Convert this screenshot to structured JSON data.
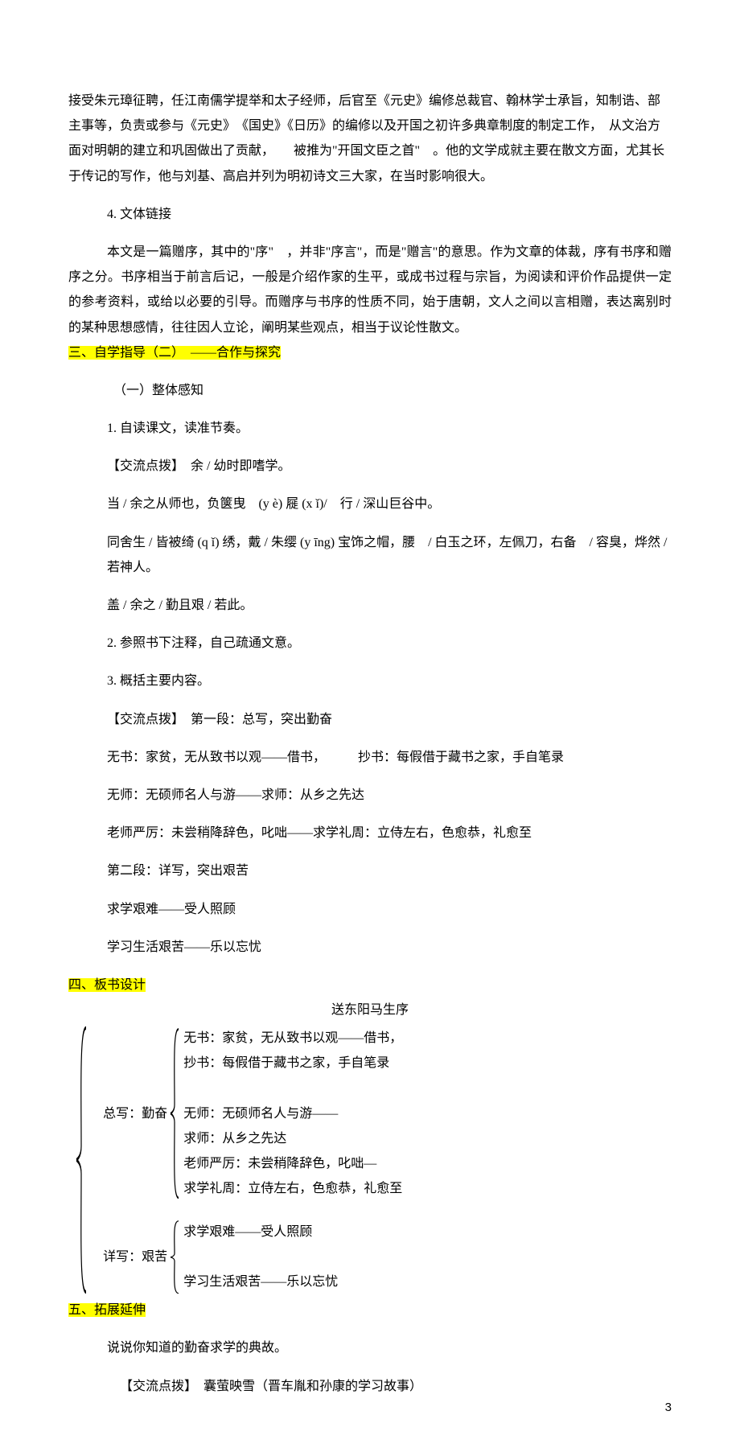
{
  "intro_paragraph": "接受朱元璋征聘，任江南儒学提举和太子经师，后官至《元史》编修总裁官、翰林学士承旨，知制诰、部主事等，负责或参与《元史》　《国史》《日历》的编修以及开国之初许多典章制度的制定工作，　从文治方面对明朝的建立和巩固做出了贡献，　　被推为\"开国文臣之首\"　。他的文学成就主要在散文方面，尤其长于传记的写作，他与刘基、高启并列为明初诗文三大家，在当时影响很大。",
  "item4_label": "4. 文体链接",
  "item4_para": "本文是一篇赠序，其中的\"序\"　，并非\"序言\"，而是\"赠言\"的意思。作为文章的体裁，序有书序和赠序之分。书序相当于前言后记，一般是介绍作家的生平，或成书过程与宗旨，为阅读和评价作品提供一定的参考资料，或给以必要的引导。而赠序与书序的性质不同，始于唐朝，文人之间以言相赠，表达离别时的某种思想感情，往往因人立论，阐明某些观点，相当于议论性散文。",
  "sec3_title": "三、自学指导（二）　——合作与探究",
  "sec3_sub1": "（一）整体感知",
  "sec3_p1": "1. 自读课文，读准节奏。",
  "sec3_p2": "【交流点拨】　余 / 幼时即嗜学。",
  "sec3_p3": "当 / 余之从师也，负箧曳　(y è) 屣 (x ǐ)/　行 / 深山巨谷中。",
  "sec3_p4": "同舍生 / 皆被绮 (q ǐ) 绣，戴 / 朱缨 (y īng) 宝饰之帽，腰　/ 白玉之环，左佩刀，右备　/ 容臭，烨然 / 若神人。",
  "sec3_p5": "盖 / 余之 / 勤且艰 / 若此。",
  "sec3_p6": "2. 参照书下注释，自己疏通文意。",
  "sec3_p7": "3. 概括主要内容。",
  "sec3_p8": "【交流点拨】　第一段：总写，突出勤奋",
  "sec3_p9": "无书：家贫，无从致书以观——借书，　　　抄书：每假借于藏书之家，手自笔录",
  "sec3_p10": "无师：无硕师名人与游——求师：从乡之先达",
  "sec3_p11": "老师严厉：未尝稍降辞色，叱咄——求学礼周：立侍左右，色愈恭，礼愈至",
  "sec3_p12": "第二段：详写，突出艰苦",
  "sec3_p13": "求学艰难——受人照顾",
  "sec3_p14": "学习生活艰苦——乐以忘忧",
  "sec4_title": "四、板书设计",
  "board_title": "送东阳马生序",
  "board": {
    "group1_label": "总写：勤奋",
    "group1_lines": [
      "无书：家贫，无从致书以观——借书，",
      "抄书：每假借于藏书之家，手自笔录",
      "",
      "无师：无硕师名人与游——",
      "求师：从乡之先达",
      "老师严厉：未尝稍降辞色，叱咄—",
      "求学礼周：立侍左右，色愈恭，礼愈至"
    ],
    "group2_label": "详写：艰苦",
    "group2_lines": [
      "求学艰难——受人照顾",
      "",
      "学习生活艰苦——乐以忘忧"
    ]
  },
  "sec5_title": "五、拓展延伸",
  "sec5_p1": "说说你知道的勤奋求学的典故。",
  "sec5_p2": "【交流点拨】　囊萤映雪（晋车胤和孙康的学习故事）",
  "page_number": "3"
}
